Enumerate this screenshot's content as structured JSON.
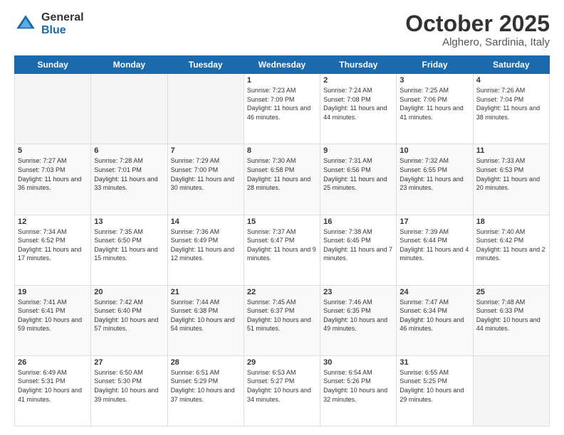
{
  "logo": {
    "general": "General",
    "blue": "Blue"
  },
  "title": "October 2025",
  "location": "Alghero, Sardinia, Italy",
  "headers": [
    "Sunday",
    "Monday",
    "Tuesday",
    "Wednesday",
    "Thursday",
    "Friday",
    "Saturday"
  ],
  "weeks": [
    [
      {
        "day": "",
        "info": ""
      },
      {
        "day": "",
        "info": ""
      },
      {
        "day": "",
        "info": ""
      },
      {
        "day": "1",
        "info": "Sunrise: 7:23 AM\nSunset: 7:09 PM\nDaylight: 11 hours and 46 minutes."
      },
      {
        "day": "2",
        "info": "Sunrise: 7:24 AM\nSunset: 7:08 PM\nDaylight: 11 hours and 44 minutes."
      },
      {
        "day": "3",
        "info": "Sunrise: 7:25 AM\nSunset: 7:06 PM\nDaylight: 11 hours and 41 minutes."
      },
      {
        "day": "4",
        "info": "Sunrise: 7:26 AM\nSunset: 7:04 PM\nDaylight: 11 hours and 38 minutes."
      }
    ],
    [
      {
        "day": "5",
        "info": "Sunrise: 7:27 AM\nSunset: 7:03 PM\nDaylight: 11 hours and 36 minutes."
      },
      {
        "day": "6",
        "info": "Sunrise: 7:28 AM\nSunset: 7:01 PM\nDaylight: 11 hours and 33 minutes."
      },
      {
        "day": "7",
        "info": "Sunrise: 7:29 AM\nSunset: 7:00 PM\nDaylight: 11 hours and 30 minutes."
      },
      {
        "day": "8",
        "info": "Sunrise: 7:30 AM\nSunset: 6:58 PM\nDaylight: 11 hours and 28 minutes."
      },
      {
        "day": "9",
        "info": "Sunrise: 7:31 AM\nSunset: 6:56 PM\nDaylight: 11 hours and 25 minutes."
      },
      {
        "day": "10",
        "info": "Sunrise: 7:32 AM\nSunset: 6:55 PM\nDaylight: 11 hours and 23 minutes."
      },
      {
        "day": "11",
        "info": "Sunrise: 7:33 AM\nSunset: 6:53 PM\nDaylight: 11 hours and 20 minutes."
      }
    ],
    [
      {
        "day": "12",
        "info": "Sunrise: 7:34 AM\nSunset: 6:52 PM\nDaylight: 11 hours and 17 minutes."
      },
      {
        "day": "13",
        "info": "Sunrise: 7:35 AM\nSunset: 6:50 PM\nDaylight: 11 hours and 15 minutes."
      },
      {
        "day": "14",
        "info": "Sunrise: 7:36 AM\nSunset: 6:49 PM\nDaylight: 11 hours and 12 minutes."
      },
      {
        "day": "15",
        "info": "Sunrise: 7:37 AM\nSunset: 6:47 PM\nDaylight: 11 hours and 9 minutes."
      },
      {
        "day": "16",
        "info": "Sunrise: 7:38 AM\nSunset: 6:45 PM\nDaylight: 11 hours and 7 minutes."
      },
      {
        "day": "17",
        "info": "Sunrise: 7:39 AM\nSunset: 6:44 PM\nDaylight: 11 hours and 4 minutes."
      },
      {
        "day": "18",
        "info": "Sunrise: 7:40 AM\nSunset: 6:42 PM\nDaylight: 11 hours and 2 minutes."
      }
    ],
    [
      {
        "day": "19",
        "info": "Sunrise: 7:41 AM\nSunset: 6:41 PM\nDaylight: 10 hours and 59 minutes."
      },
      {
        "day": "20",
        "info": "Sunrise: 7:42 AM\nSunset: 6:40 PM\nDaylight: 10 hours and 57 minutes."
      },
      {
        "day": "21",
        "info": "Sunrise: 7:44 AM\nSunset: 6:38 PM\nDaylight: 10 hours and 54 minutes."
      },
      {
        "day": "22",
        "info": "Sunrise: 7:45 AM\nSunset: 6:37 PM\nDaylight: 10 hours and 51 minutes."
      },
      {
        "day": "23",
        "info": "Sunrise: 7:46 AM\nSunset: 6:35 PM\nDaylight: 10 hours and 49 minutes."
      },
      {
        "day": "24",
        "info": "Sunrise: 7:47 AM\nSunset: 6:34 PM\nDaylight: 10 hours and 46 minutes."
      },
      {
        "day": "25",
        "info": "Sunrise: 7:48 AM\nSunset: 6:33 PM\nDaylight: 10 hours and 44 minutes."
      }
    ],
    [
      {
        "day": "26",
        "info": "Sunrise: 6:49 AM\nSunset: 5:31 PM\nDaylight: 10 hours and 41 minutes."
      },
      {
        "day": "27",
        "info": "Sunrise: 6:50 AM\nSunset: 5:30 PM\nDaylight: 10 hours and 39 minutes."
      },
      {
        "day": "28",
        "info": "Sunrise: 6:51 AM\nSunset: 5:29 PM\nDaylight: 10 hours and 37 minutes."
      },
      {
        "day": "29",
        "info": "Sunrise: 6:53 AM\nSunset: 5:27 PM\nDaylight: 10 hours and 34 minutes."
      },
      {
        "day": "30",
        "info": "Sunrise: 6:54 AM\nSunset: 5:26 PM\nDaylight: 10 hours and 32 minutes."
      },
      {
        "day": "31",
        "info": "Sunrise: 6:55 AM\nSunset: 5:25 PM\nDaylight: 10 hours and 29 minutes."
      },
      {
        "day": "",
        "info": ""
      }
    ]
  ]
}
